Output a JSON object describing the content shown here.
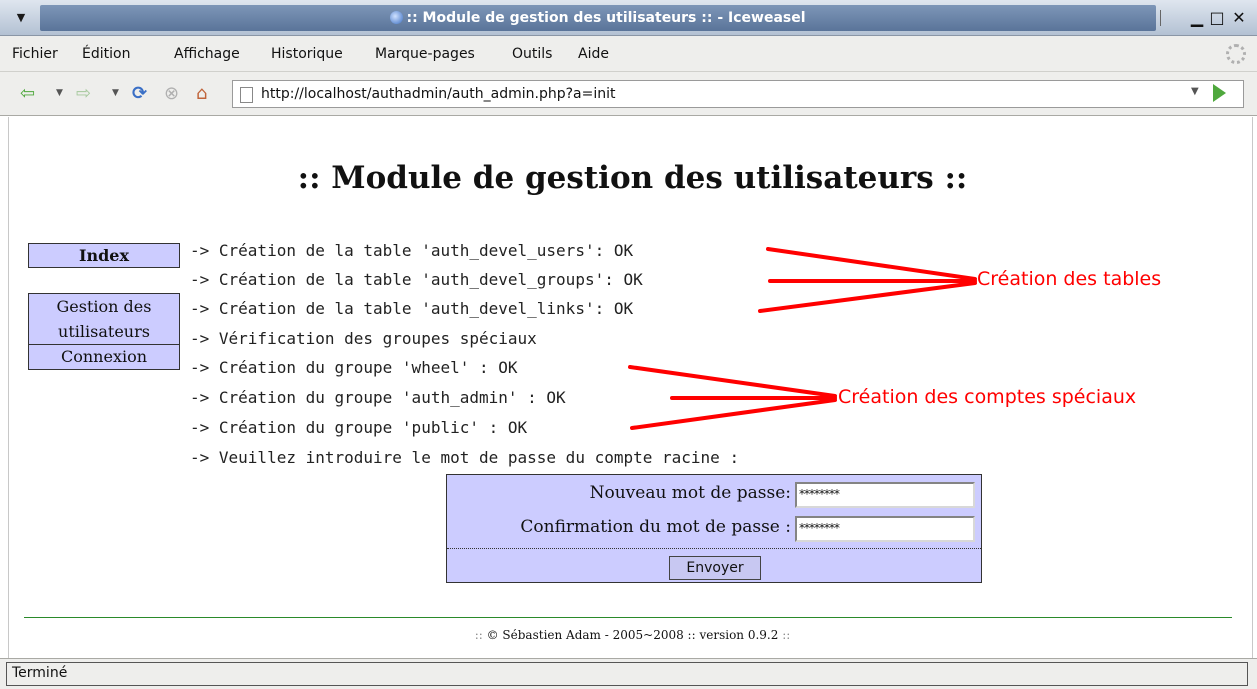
{
  "window": {
    "title": ":: Module de gestion des utilisateurs :: - Iceweasel",
    "controls": {
      "minimize": "▁",
      "maximize": "□",
      "close": "✕",
      "menu": "▼"
    }
  },
  "menubar": {
    "items": [
      {
        "label": "Fichier"
      },
      {
        "label": "Édition"
      },
      {
        "label": "Affichage"
      },
      {
        "label": "Historique"
      },
      {
        "label": "Marque-pages"
      },
      {
        "label": "Outils"
      },
      {
        "label": "Aide"
      }
    ]
  },
  "navbar": {
    "back_icon": "⇦",
    "forward_icon": "⇨",
    "reload_icon": "⟳",
    "stop_icon": "⊗",
    "home_icon": "⌂",
    "url": "http://localhost/authadmin/auth_admin.php?a=init"
  },
  "page": {
    "title": ":: Module de gestion des utilisateurs ::",
    "sidemenu": {
      "index": "Index",
      "users_line1": "Gestion des",
      "users_line2": "utilisateurs",
      "connexion": "Connexion"
    },
    "log": [
      "-> Création de la table 'auth_devel_users': OK",
      "-> Création de la table 'auth_devel_groups': OK",
      "-> Création de la table 'auth_devel_links': OK",
      "-> Vérification des groupes spéciaux",
      "-> Création du groupe 'wheel' : OK",
      "-> Création du groupe 'auth_admin' : OK",
      "-> Création du groupe 'public' : OK",
      "-> Veuillez introduire le mot de passe du compte racine :"
    ],
    "form": {
      "new_password_label": "Nouveau mot de passe:",
      "new_password_value": "********",
      "confirm_label": "Confirmation du mot de passe :",
      "confirm_value": "********",
      "submit_label": "Envoyer"
    },
    "annotations": {
      "tables": "Création des tables",
      "accounts": "Création des comptes spéciaux",
      "color": "#ff0000"
    },
    "footer": {
      "prefix": "::",
      "text": "© Sébastien Adam - 2005~2008 :: version 0.9.2",
      "suffix": "::"
    }
  },
  "status": {
    "text": "Terminé"
  }
}
